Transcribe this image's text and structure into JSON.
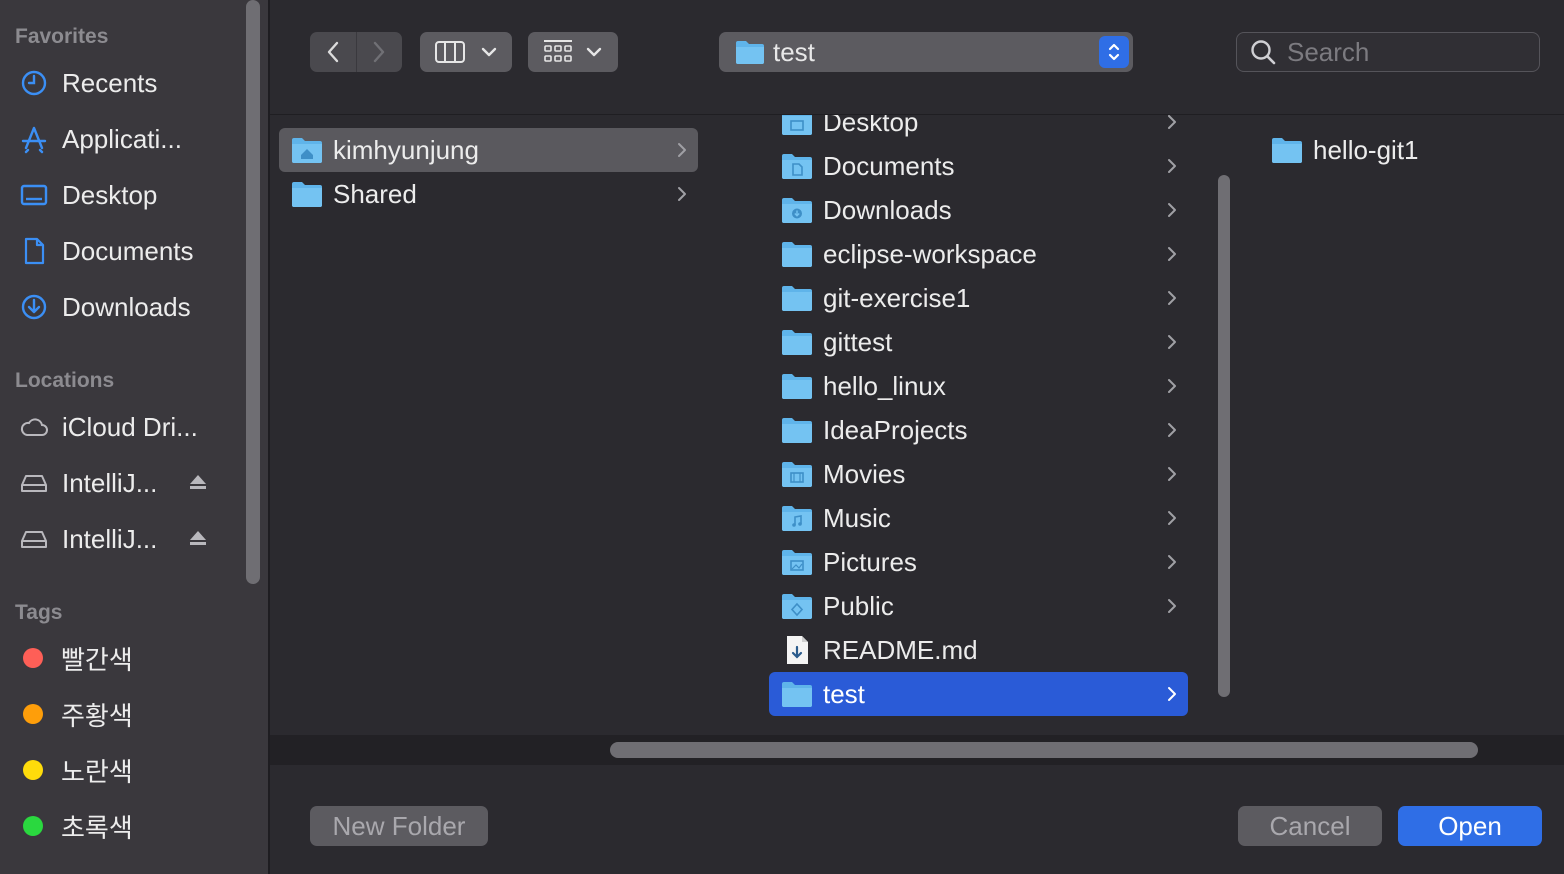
{
  "sidebar": {
    "favorites_label": "Favorites",
    "favorites": [
      {
        "label": "Recents",
        "icon": "clock-icon"
      },
      {
        "label": "Applicati...",
        "icon": "applications-icon"
      },
      {
        "label": "Desktop",
        "icon": "desktop-icon"
      },
      {
        "label": "Documents",
        "icon": "document-icon"
      },
      {
        "label": "Downloads",
        "icon": "download-icon"
      }
    ],
    "locations_label": "Locations",
    "locations": [
      {
        "label": "iCloud Dri...",
        "icon": "cloud-icon"
      },
      {
        "label": "IntelliJ...",
        "icon": "drive-icon",
        "eject": true
      },
      {
        "label": "IntelliJ...",
        "icon": "drive-icon",
        "eject": true
      }
    ],
    "tags_label": "Tags",
    "tags": [
      {
        "label": "빨간색",
        "color": "#fe5f57"
      },
      {
        "label": "주황색",
        "color": "#fe9e0a"
      },
      {
        "label": "노란색",
        "color": "#fedc0b"
      },
      {
        "label": "초록색",
        "color": "#2ad83f"
      }
    ]
  },
  "toolbar": {
    "path_label": "test",
    "search_placeholder": "Search"
  },
  "columns": {
    "col1": [
      {
        "label": "kimhyunjung",
        "icon": "home-folder-icon",
        "selected": true
      },
      {
        "label": "Shared",
        "icon": "folder-icon"
      }
    ],
    "col2": [
      {
        "label": "Desktop",
        "icon": "desktop-folder-icon"
      },
      {
        "label": "Documents",
        "icon": "documents-folder-icon"
      },
      {
        "label": "Downloads",
        "icon": "downloads-folder-icon"
      },
      {
        "label": "eclipse-workspace",
        "icon": "folder-icon"
      },
      {
        "label": "git-exercise1",
        "icon": "folder-icon"
      },
      {
        "label": "gittest",
        "icon": "folder-icon"
      },
      {
        "label": "hello_linux",
        "icon": "folder-icon"
      },
      {
        "label": "IdeaProjects",
        "icon": "folder-icon"
      },
      {
        "label": "Movies",
        "icon": "movies-folder-icon"
      },
      {
        "label": "Music",
        "icon": "music-folder-icon"
      },
      {
        "label": "Pictures",
        "icon": "pictures-folder-icon"
      },
      {
        "label": "Public",
        "icon": "public-folder-icon"
      },
      {
        "label": "README.md",
        "icon": "markdown-file-icon",
        "file": true
      },
      {
        "label": "test",
        "icon": "folder-icon",
        "active": true
      }
    ],
    "col3": [
      {
        "label": "hello-git1",
        "icon": "folder-icon"
      }
    ]
  },
  "buttons": {
    "new_folder": "New Folder",
    "cancel": "Cancel",
    "open": "Open"
  },
  "colors": {
    "accent": "#2f6ee6",
    "selection": "#2a5bd7",
    "folder": "#5fb4ea"
  }
}
